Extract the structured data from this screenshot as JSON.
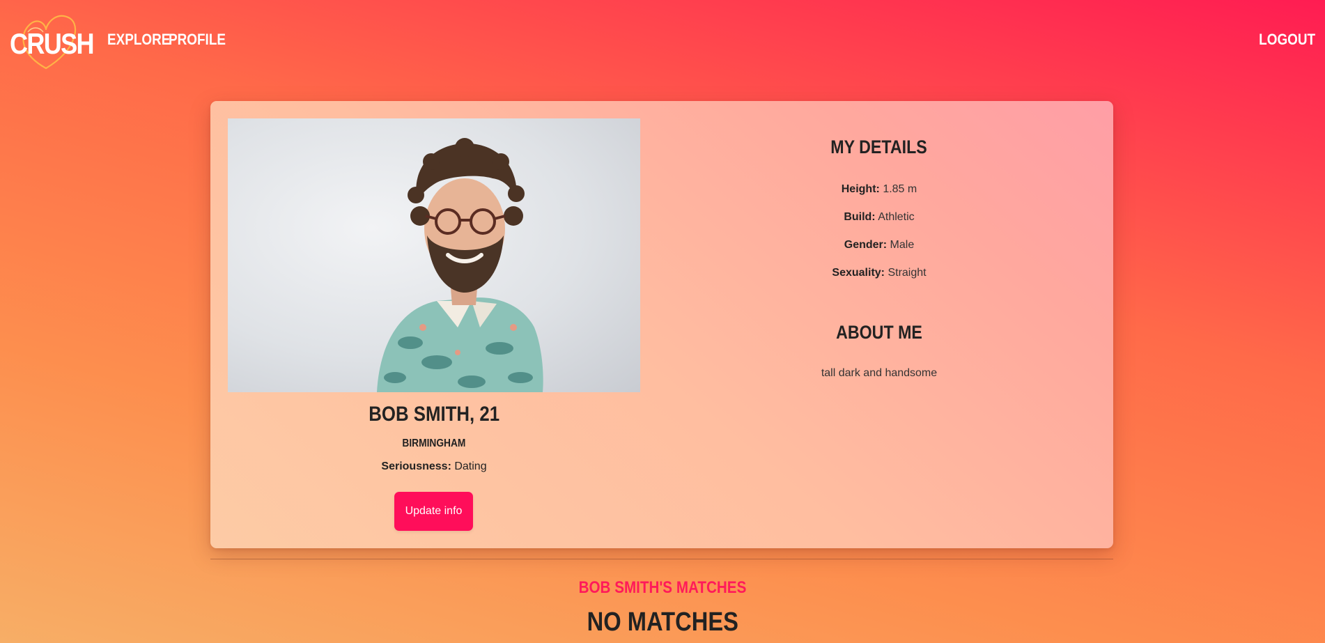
{
  "nav": {
    "logo": "CRUSH",
    "links": [
      "EXPLORE",
      "PROFILE"
    ],
    "logout": "LOGOUT"
  },
  "profile": {
    "name": "BOB SMITH, 21",
    "city": "BIRMINGHAM",
    "seriousness_label": "Seriousness:",
    "seriousness_value": "Dating",
    "update_button": "Update info",
    "photo": {
      "description_icon": "profile-photo"
    }
  },
  "details": {
    "heading": "MY DETAILS",
    "items": [
      {
        "label": "Height:",
        "value": "1.85 m"
      },
      {
        "label": "Build:",
        "value": "Athletic"
      },
      {
        "label": "Gender:",
        "value": "Male"
      },
      {
        "label": "Sexuality:",
        "value": "Straight"
      }
    ]
  },
  "about": {
    "heading": "ABOUT ME",
    "text": "tall dark and handsome"
  },
  "matches": {
    "title": "BOB SMITH'S MATCHES",
    "empty": "NO MATCHES"
  },
  "colors": {
    "accent": "#ff0e5a",
    "matches_title": "#ff1a5a",
    "text_dark": "#222222"
  }
}
